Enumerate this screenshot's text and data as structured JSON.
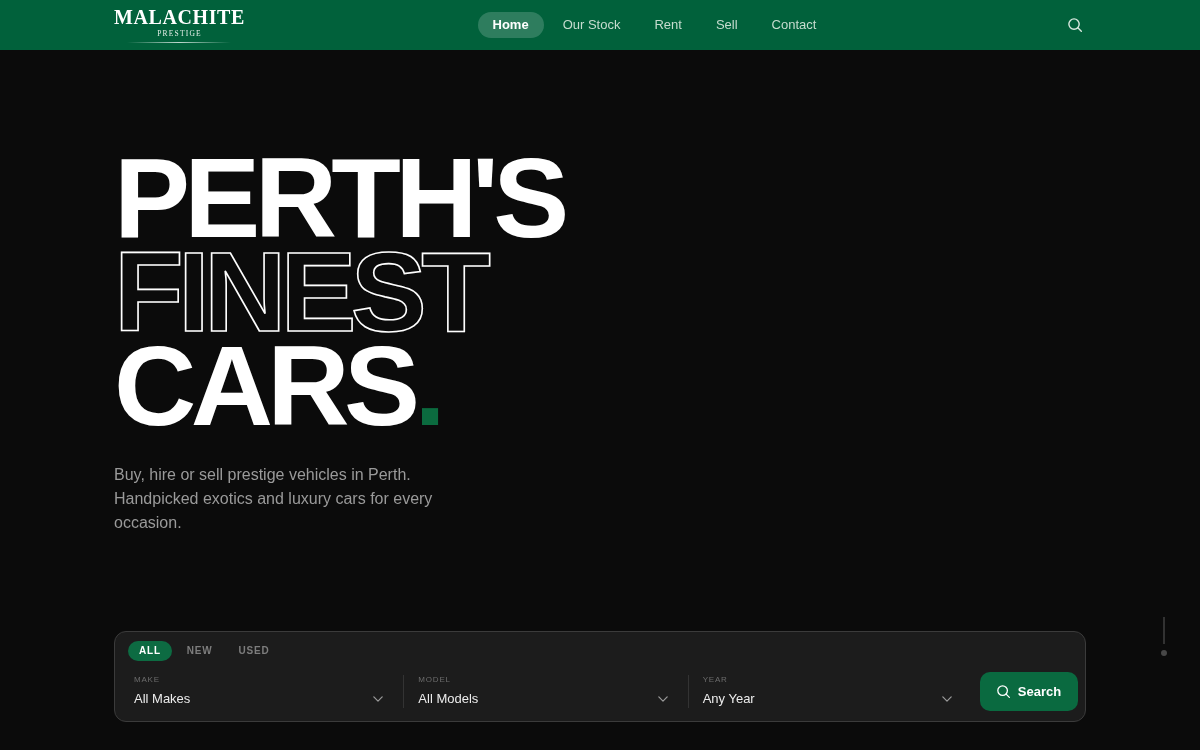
{
  "brand": {
    "name": "MALACHITE",
    "tagline": "PRESTIGE"
  },
  "nav": [
    {
      "label": "Home",
      "selected": true
    },
    {
      "label": "Our Stock",
      "selected": false
    },
    {
      "label": "Rent",
      "selected": false
    },
    {
      "label": "Sell",
      "selected": false
    },
    {
      "label": "Contact",
      "selected": false
    }
  ],
  "hero": {
    "headline": [
      {
        "text": "PERTH'S",
        "kind": "solid"
      },
      {
        "text": "FINEST",
        "kind": "outline"
      },
      {
        "text": "CARS",
        "kind": "solid",
        "accent": "."
      }
    ],
    "subtitle": "Buy, hire or sell prestige vehicles in Perth. Handpicked exotics and luxury cars for every occasion."
  },
  "search_panel": {
    "tabs": [
      {
        "label": "ALL",
        "selected": true
      },
      {
        "label": "NEW",
        "selected": false
      },
      {
        "label": "USED",
        "selected": false
      }
    ],
    "fields": [
      {
        "label": "MAKE",
        "value": "All Makes"
      },
      {
        "label": "MODEL",
        "value": "All Models"
      },
      {
        "label": "YEAR",
        "value": "Any Year"
      }
    ],
    "button": "Search"
  }
}
